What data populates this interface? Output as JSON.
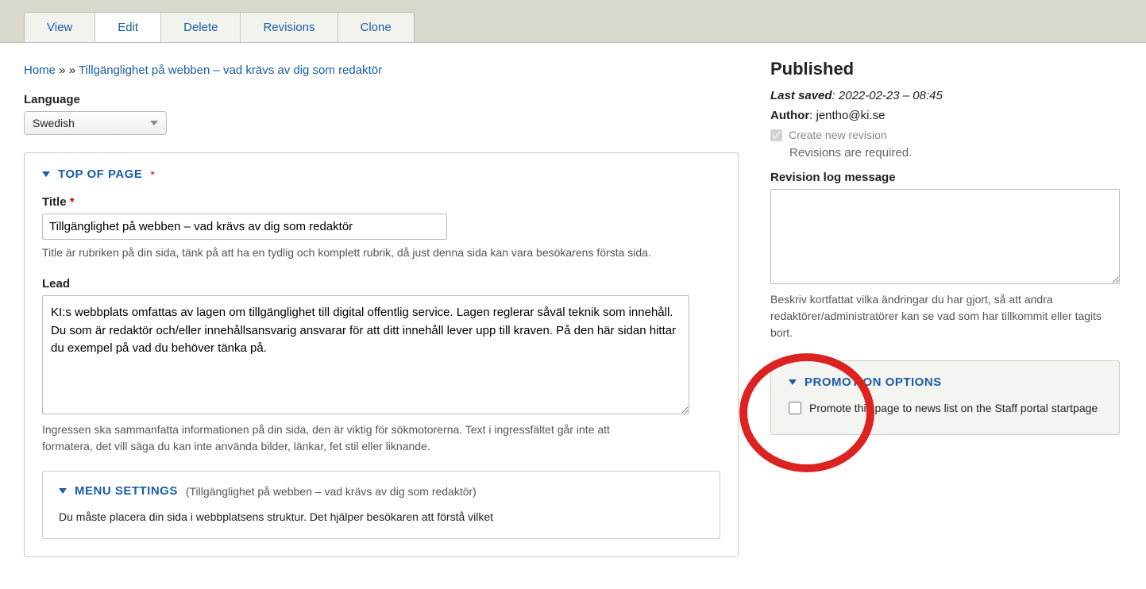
{
  "tabs": {
    "view": "View",
    "edit": "Edit",
    "delete": "Delete",
    "revisions": "Revisions",
    "clone": "Clone"
  },
  "breadcrumb": {
    "home": "Home",
    "sep": " » » ",
    "current": "Tillgänglighet på webben – vad krävs av dig som redaktör"
  },
  "language": {
    "label": "Language",
    "value": "Swedish"
  },
  "top_of_page": {
    "heading": "TOP OF PAGE",
    "title_label": "Title",
    "title_value": "Tillgänglighet på webben – vad krävs av dig som redaktör",
    "title_help": "Title är rubriken på din sida, tänk på att ha en tydlig och komplett rubrik, då just denna sida kan vara besökarens första sida.",
    "lead_label": "Lead",
    "lead_value": "KI:s webbplats omfattas av lagen om tillgänglighet till digital offentlig service. Lagen reglerar såväl teknik som innehåll. Du som är redaktör och/eller innehållsansvarig ansvarar för att ditt innehåll lever upp till kraven. På den här sidan hittar du exempel på vad du behöver tänka på.",
    "lead_help": "Ingressen ska sammanfatta informationen på din sida, den är viktig för sökmotorerna. Text i ingressfältet går inte att formatera, det vill säga du kan inte använda bilder, länkar, fet stil eller liknande."
  },
  "menu_settings": {
    "heading": "MENU SETTINGS",
    "sub": "(Tillgänglighet på webben – vad krävs av dig som redaktör)",
    "body": "Du måste placera din sida i webbplatsens struktur. Det hjälper besökaren att förstå vilket"
  },
  "sidebar": {
    "published": "Published",
    "last_saved_label": "Last saved",
    "last_saved_value": ": 2022-02-23 – 08:45",
    "author_label": "Author",
    "author_value": ": jentho@ki.se",
    "create_new_revision": "Create new revision",
    "revisions_required": "Revisions are required.",
    "rev_log_label": "Revision log message",
    "rev_log_help": "Beskriv kortfattat vilka ändringar du har gjort, så att andra redaktörer/administratörer kan se vad som har tillkommit eller tagits bort."
  },
  "promotion": {
    "heading": "PROMOTION OPTIONS",
    "checkbox_label": "Promote this page to news list on the Staff portal startpage"
  }
}
